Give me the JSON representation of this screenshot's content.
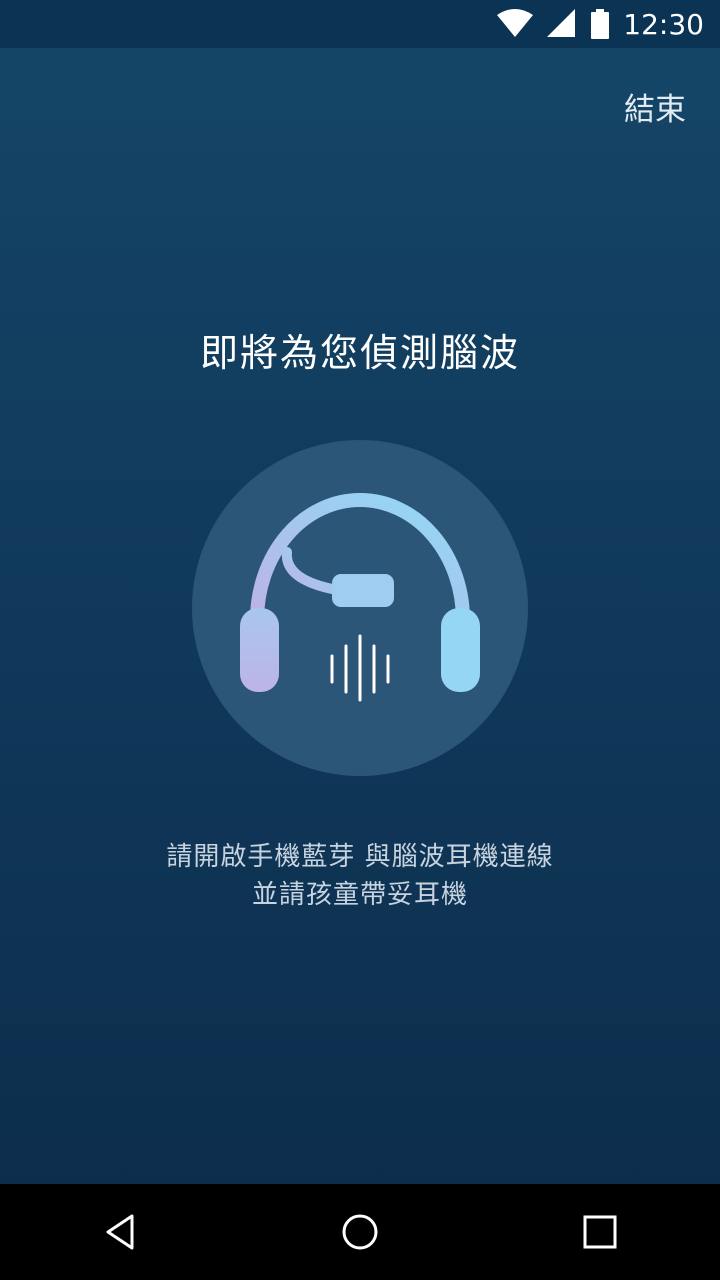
{
  "status_bar": {
    "time": "12:30"
  },
  "header": {
    "end_label": "結束"
  },
  "main": {
    "title": "即將為您偵測腦波",
    "instruction_line1": "請開啟手機藍芽 與腦波耳機連線",
    "instruction_line2": "並請孩童帶妥耳機"
  },
  "icons": {
    "headphone": "headphone-with-mic-icon",
    "wave": "sound-wave-icon",
    "back": "back-triangle-icon",
    "home": "home-circle-icon",
    "recents": "recents-square-icon"
  },
  "colors": {
    "background_top": "#154668",
    "background_bottom": "#0c2c4a",
    "circle": "#2c5677",
    "headphone_gradient_start": "#bcb3e6",
    "headphone_gradient_end": "#8fdaf6"
  }
}
